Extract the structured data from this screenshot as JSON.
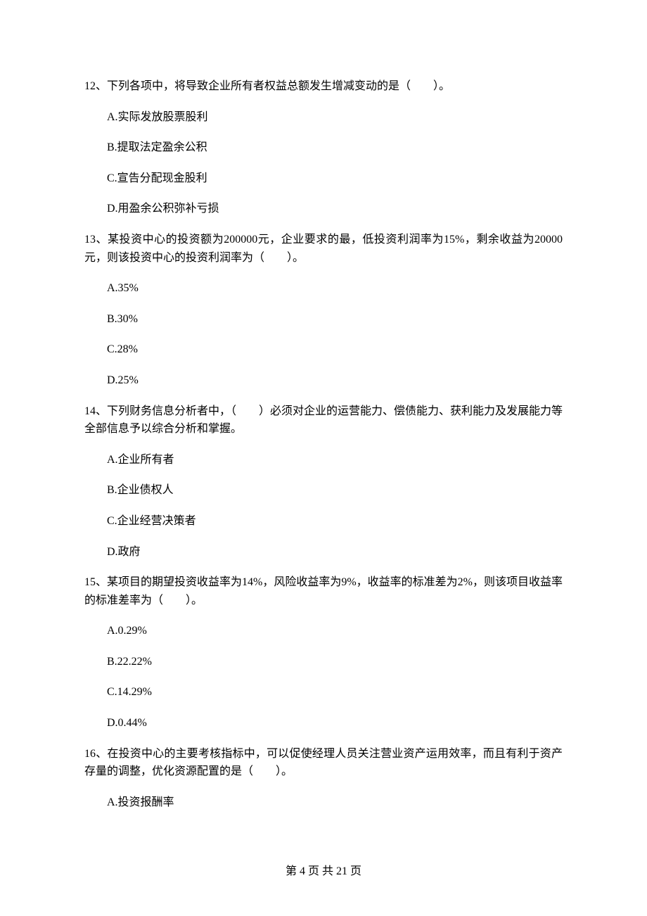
{
  "q12": {
    "stem": "12、下列各项中，将导致企业所有者权益总额发生增减变动的是（　　）。",
    "a": "A.实际发放股票股利",
    "b": "B.提取法定盈余公积",
    "c": "C.宣告分配现金股利",
    "d": "D.用盈余公积弥补亏损"
  },
  "q13": {
    "stem": "13、某投资中心的投资额为200000元，企业要求的最，低投资利润率为15%，剩余收益为20000元，则该投资中心的投资利润率为（　　）。",
    "a": "A.35%",
    "b": "B.30%",
    "c": "C.28%",
    "d": "D.25%"
  },
  "q14": {
    "stem": "14、下列财务信息分析者中，（　　）必须对企业的运营能力、偿债能力、获利能力及发展能力等全部信息予以综合分析和掌握。",
    "a": "A.企业所有者",
    "b": "B.企业债权人",
    "c": "C.企业经营决策者",
    "d": "D.政府"
  },
  "q15": {
    "stem": "15、某项目的期望投资收益率为14%，风险收益率为9%，收益率的标准差为2%，则该项目收益率的标准差率为（　　）。",
    "a": "A.0.29%",
    "b": "B.22.22%",
    "c": "C.14.29%",
    "d": "D.0.44%"
  },
  "q16": {
    "stem": "16、在投资中心的主要考核指标中，可以促使经理人员关注营业资产运用效率，而且有利于资产存量的调整，优化资源配置的是（　　）。",
    "a": "A.投资报酬率"
  },
  "footer": "第 4 页 共 21 页"
}
